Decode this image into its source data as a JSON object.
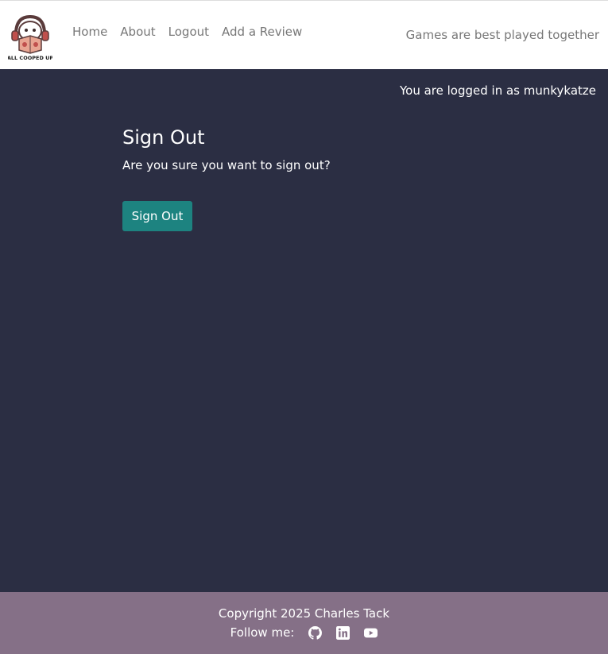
{
  "header": {
    "logo_text": "ALL COOPED UP",
    "nav": [
      "Home",
      "About",
      "Logout",
      "Add a Review"
    ],
    "tagline": "Games are best played together"
  },
  "status": {
    "logged_in_text": "You are logged in as munkykatze"
  },
  "main": {
    "title": "Sign Out",
    "message": "Are you sure you want to sign out?",
    "button_label": "Sign Out"
  },
  "footer": {
    "copyright": "Copyright 2025 Charles Tack",
    "follow_label": "Follow me:",
    "social_icons": [
      "github-icon",
      "linkedin-icon",
      "youtube-icon"
    ]
  },
  "colors": {
    "background": "#2b2e43",
    "button": "#1d8380",
    "footer": "#857087"
  }
}
